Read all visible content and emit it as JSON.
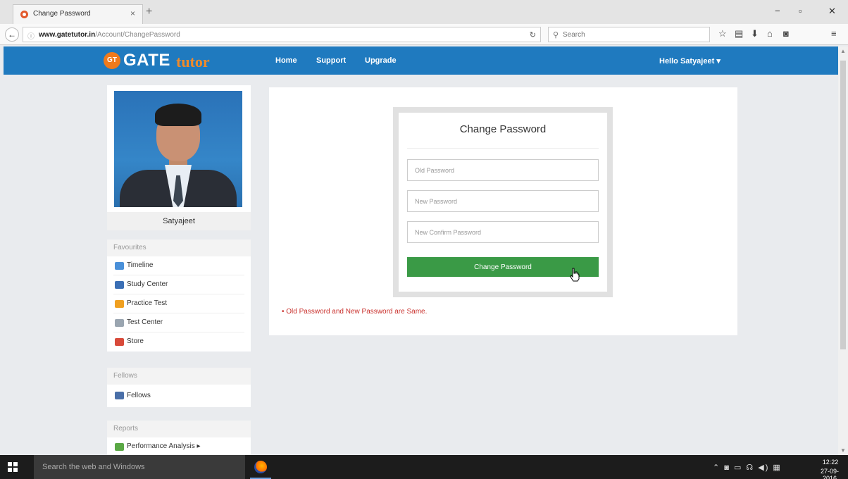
{
  "browser": {
    "tab_title": "Change Password",
    "new_tab": "+",
    "tab_close": "×",
    "url_host": "www.gatetutor.in",
    "url_path": "/Account/ChangePassword",
    "search_placeholder": "Search",
    "window_controls": [
      "−",
      "▫",
      "✕"
    ]
  },
  "site": {
    "logo_badge": "GT",
    "logo_main": "GATE",
    "logo_sub": "tutor",
    "nav": [
      "Home",
      "Support",
      "Upgrade"
    ],
    "user_menu": "Hello Satyajeet ▾"
  },
  "profile": {
    "name": "Satyajeet"
  },
  "favourites": {
    "title": "Favourites",
    "items": [
      {
        "label": "Timeline",
        "icon": "timeline-icon",
        "color": "#4a90d9"
      },
      {
        "label": "Study Center",
        "icon": "study-center-icon",
        "color": "#3b6fb5"
      },
      {
        "label": "Practice Test",
        "icon": "practice-test-icon",
        "color": "#f0a020"
      },
      {
        "label": "Test Center",
        "icon": "test-center-icon",
        "color": "#9aa5b0"
      },
      {
        "label": "Store",
        "icon": "store-icon",
        "color": "#d84a3a"
      }
    ]
  },
  "fellows": {
    "title": "Fellows",
    "items": [
      {
        "label": "Fellows",
        "icon": "fellows-icon",
        "color": "#4a6fa8"
      }
    ]
  },
  "reports": {
    "title": "Reports",
    "items": [
      {
        "label": "Performance Analysis ▸",
        "icon": "performance-analysis-icon",
        "color": "#5aa845"
      }
    ]
  },
  "change_password": {
    "title": "Change Password",
    "old_placeholder": "Old Password",
    "new_placeholder": "New Password",
    "confirm_placeholder": "New Confirm Password",
    "button_label": "Change Password",
    "error": "• Old Password and New Password are Same."
  },
  "taskbar": {
    "search_text": "Search the web and Windows",
    "tray": "⌃ ◙ ▭ ☊ ◀) ▦",
    "time": "12:22",
    "date": "27-09-2016"
  },
  "colors": {
    "header": "#1f7abf",
    "button": "#3a9a46",
    "error": "#c9302c",
    "logo_accent": "#f07a1c"
  }
}
